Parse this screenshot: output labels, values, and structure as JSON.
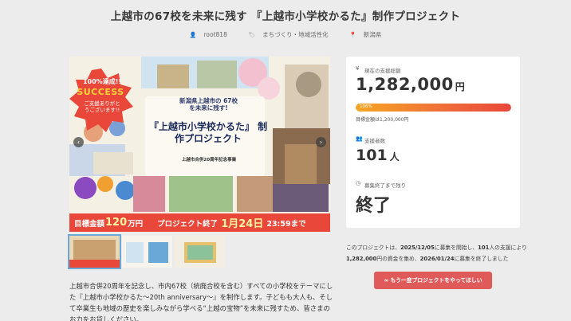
{
  "project": {
    "title": "上越市の67校を未来に残す 『上越市小学校かるた』制作プロジェクト",
    "author": "root818",
    "category": "まちづくり・地域活性化",
    "location": "新潟県"
  },
  "slide": {
    "badge_line1": "100%達成!!",
    "badge_line2": "SUCCESS",
    "badge_line3": "ご支援ありがとうございます!!",
    "poster_sub": "新潟県上越市の 67校を未来に残す!",
    "poster_main": "『上越市小学校かるた』 制作プロジェクト",
    "poster_small": "上越市合併20周年記念事業",
    "footer_goal_label": "目標金額",
    "footer_goal_value": "120",
    "footer_goal_unit": "万円",
    "footer_end_label": "プロジェクト終了",
    "footer_end_date": "1月24日",
    "footer_end_time": "23:59まで",
    "prev_arrow": "‹",
    "next_arrow": "›"
  },
  "description": "上越市合併20周年を記念し、市内67校（統廃合校を含む）すべての小学校をテーマにした『上越市小学校かるた〜20th anniversary〜』を制作します。子どもも大人も、そして卒業生も地域の歴史を楽しみながら学べる“上越の宝物”を未来に残すため、皆さまのお力をお貸しください。",
  "stats": {
    "raised_label": "現在の支援総額",
    "raised_value": "1,282,000",
    "raised_unit": "円",
    "progress_percent": 100,
    "progress_label": "106%",
    "goal_text": "目標金額は1,200,000円",
    "backers_label": "支援者数",
    "backers_value": "101",
    "backers_unit": "人",
    "remaining_label": "募集終了まで残り",
    "remaining_value": "終了"
  },
  "summary": {
    "p1": "このプロジェクトは、",
    "start": "2025/12/05",
    "p2": "に募集を開始し、",
    "backers": "101",
    "p3": "人の支援により",
    "amount": "1,282,000",
    "p4": "円の資金を集め、",
    "end": "2026/01/24",
    "p5": "に募集を終了しました"
  },
  "cta": {
    "label": "∞ もう一度プロジェクトをやってほしい"
  },
  "colors": {
    "accent_red": "#e8473a",
    "button_red": "#e05a5a",
    "progress_start": "#f6a623",
    "progress_end": "#e8473a"
  }
}
